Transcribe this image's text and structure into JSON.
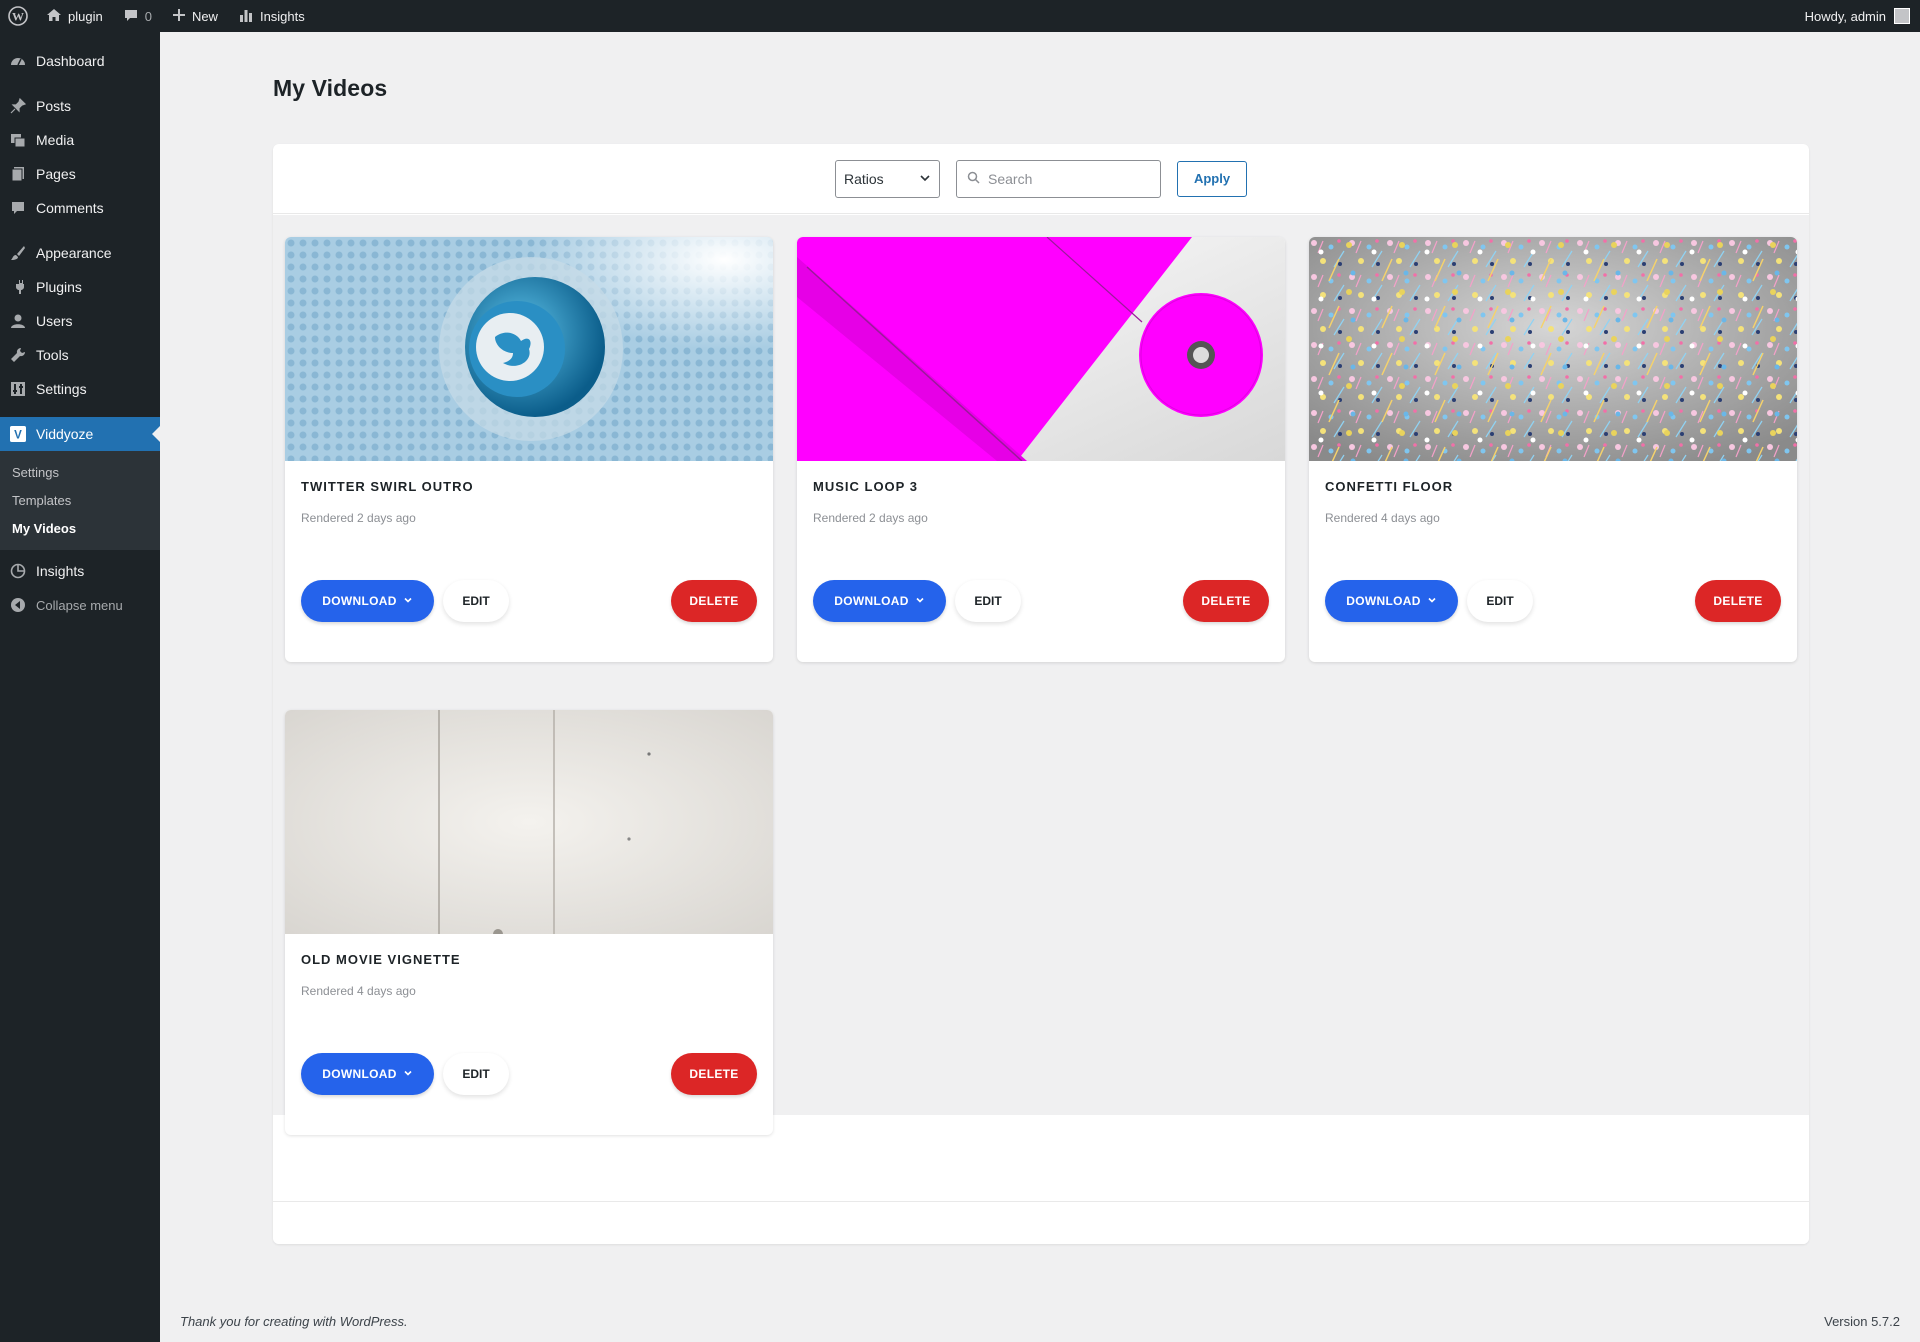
{
  "adminbar": {
    "site_name": "plugin",
    "comments_count": "0",
    "new_label": "New",
    "insights_label": "Insights",
    "greeting": "Howdy, admin"
  },
  "sidebar": {
    "items": [
      {
        "label": "Dashboard",
        "icon": "dashboard-icon"
      },
      {
        "label": "Posts",
        "icon": "pin-icon"
      },
      {
        "label": "Media",
        "icon": "media-icon"
      },
      {
        "label": "Pages",
        "icon": "pages-icon"
      },
      {
        "label": "Comments",
        "icon": "comment-icon"
      },
      {
        "label": "Appearance",
        "icon": "brush-icon"
      },
      {
        "label": "Plugins",
        "icon": "plugin-icon"
      },
      {
        "label": "Users",
        "icon": "user-icon"
      },
      {
        "label": "Tools",
        "icon": "wrench-icon"
      },
      {
        "label": "Settings",
        "icon": "settings-icon"
      },
      {
        "label": "Viddyoze",
        "icon": "viddyoze-icon"
      }
    ],
    "submenu": [
      "Settings",
      "Templates",
      "My Videos"
    ],
    "insights": "Insights",
    "collapse": "Collapse menu"
  },
  "page": {
    "title": "My Videos"
  },
  "filters": {
    "ratio_selected": "Ratios",
    "search_placeholder": "Search",
    "apply_label": "Apply"
  },
  "buttons": {
    "download": "DOWNLOAD",
    "edit": "EDIT",
    "delete": "DELETE"
  },
  "videos": [
    {
      "title": "TWITTER SWIRL OUTRO",
      "meta": "Rendered 2 days ago"
    },
    {
      "title": "MUSIC LOOP 3",
      "meta": "Rendered 2 days ago"
    },
    {
      "title": "CONFETTI FLOOR",
      "meta": "Rendered 4 days ago"
    },
    {
      "title": "OLD MOVIE VIGNETTE",
      "meta": "Rendered 4 days ago"
    }
  ],
  "footer": {
    "thanks": "Thank you for creating with WordPress.",
    "version": "Version 5.7.2"
  },
  "colors": {
    "adminbar_bg": "#1d2327",
    "accent": "#2271b1",
    "download": "#2563eb",
    "delete": "#dc2626"
  }
}
